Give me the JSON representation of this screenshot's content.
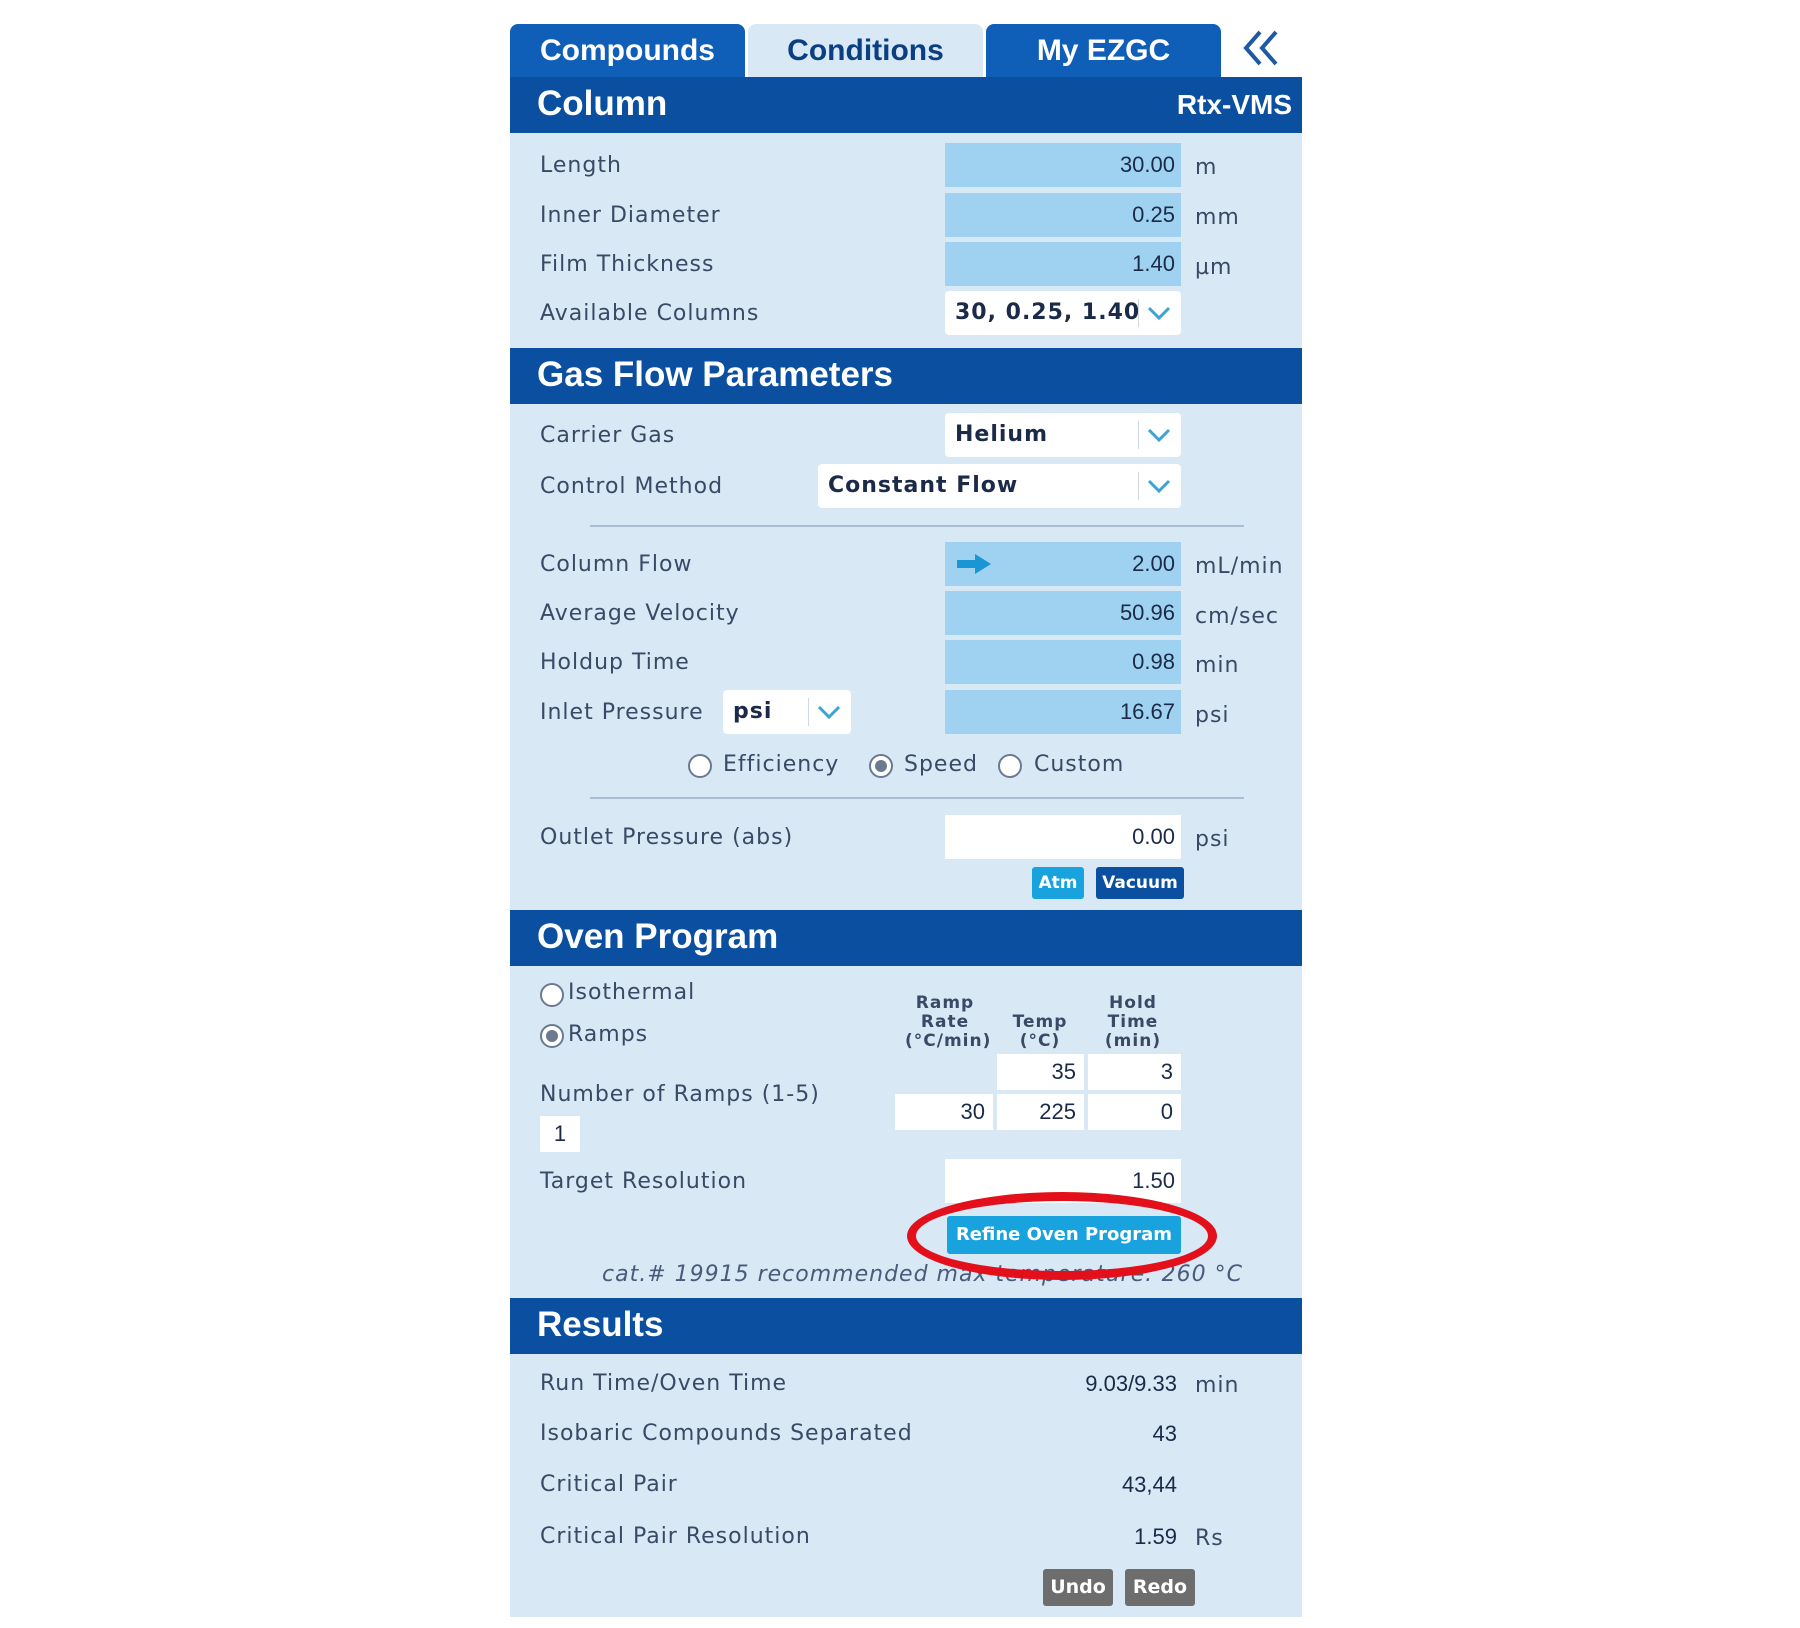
{
  "tabs": [
    {
      "label": "Compounds"
    },
    {
      "label": "Conditions"
    },
    {
      "label": "My EZGC"
    }
  ],
  "collapse_icon": "double-chevron-left-icon",
  "column": {
    "title": "Column",
    "name": "Rtx-VMS",
    "length": {
      "label": "Length",
      "value": "30.00",
      "unit": "m"
    },
    "inner_diameter": {
      "label": "Inner Diameter",
      "value": "0.25",
      "unit": "mm"
    },
    "film_thickness": {
      "label": "Film Thickness",
      "value": "1.40",
      "unit": "µm"
    },
    "available_columns": {
      "label": "Available Columns",
      "value": "30, 0.25, 1.40"
    }
  },
  "gas_flow": {
    "title": "Gas Flow Parameters",
    "carrier_gas": {
      "label": "Carrier Gas",
      "value": "Helium"
    },
    "control_method": {
      "label": "Control Method",
      "value": "Constant Flow"
    },
    "column_flow": {
      "label": "Column Flow",
      "value": "2.00",
      "unit": "mL/min"
    },
    "average_velocity": {
      "label": "Average Velocity",
      "value": "50.96",
      "unit": "cm/sec"
    },
    "holdup_time": {
      "label": "Holdup Time",
      "value": "0.98",
      "unit": "min"
    },
    "inlet_pressure": {
      "label": "Inlet Pressure",
      "unit_select": "psi",
      "value": "16.67",
      "unit": "psi"
    },
    "optimize": {
      "options": [
        "Efficiency",
        "Speed",
        "Custom"
      ],
      "selected": "Speed"
    },
    "outlet_pressure": {
      "label": "Outlet Pressure (abs)",
      "value": "0.00",
      "unit": "psi"
    },
    "atm_label": "Atm",
    "vacuum_label": "Vacuum"
  },
  "oven": {
    "title": "Oven Program",
    "isothermal_label": "Isothermal",
    "ramps_label": "Ramps",
    "mode_selected": "Ramps",
    "headers": {
      "rate": [
        "Ramp",
        "Rate",
        "(°C/min)"
      ],
      "temp": [
        "Temp",
        "(°C)"
      ],
      "hold": [
        "Hold",
        "Time",
        "(min)"
      ]
    },
    "rows": [
      {
        "rate": "",
        "temp": "35",
        "hold": "3"
      },
      {
        "rate": "30",
        "temp": "225",
        "hold": "0"
      }
    ],
    "num_ramps_label": "Number of Ramps (1-5)",
    "num_ramps": "1",
    "target_resolution_label": "Target Resolution",
    "target_resolution": "1.50",
    "refine_label": "Refine Oven Program",
    "note": "cat.# 19915 recommended max temperature: 260 °C"
  },
  "results": {
    "title": "Results",
    "run_time": {
      "label": "Run Time/Oven Time",
      "value": "9.03/9.33",
      "unit": "min"
    },
    "isobaric": {
      "label": "Isobaric Compounds Separated",
      "value": "43"
    },
    "critical_pair": {
      "label": "Critical Pair",
      "value": "43,44"
    },
    "critical_pair_resolution": {
      "label": "Critical Pair Resolution",
      "value": "1.59",
      "unit": "Rs"
    },
    "undo_label": "Undo",
    "redo_label": "Redo"
  },
  "colors": {
    "header_blue": "#0a4fa0",
    "panel_bg": "#d8e8f5",
    "field_blue": "#9fd2f0",
    "accent_light_blue": "#19a3de",
    "highlight_red": "#e3101b"
  }
}
